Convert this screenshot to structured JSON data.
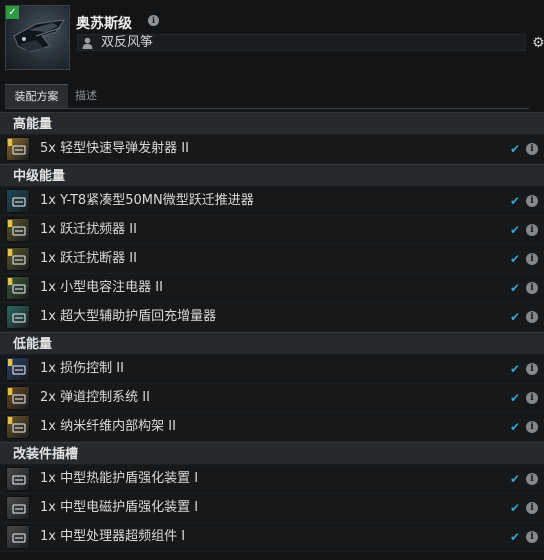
{
  "header": {
    "ship_name": "奥苏斯级",
    "info_icon": "i",
    "fitting_name": "双反风筝",
    "settings_icon": "⚙"
  },
  "tabs": [
    {
      "label": "装配方案",
      "active": true
    },
    {
      "label": "描述",
      "active": false
    }
  ],
  "colors": {
    "accent_check": "#3aa3d6",
    "meta_badge": "#e0c050",
    "valid_corner": "#2c9a3e"
  },
  "sections": [
    {
      "title": "高能量",
      "items": [
        {
          "label": "5x 轻型快速导弹发射器 II",
          "icon": "missile-launcher-icon",
          "icon_color": "#8c6b30",
          "meta": true
        }
      ]
    },
    {
      "title": "中级能量",
      "items": [
        {
          "label": "1x Y-T8紧凑型50MN微型跃迁推进器",
          "icon": "microwarpdrive-icon",
          "icon_color": "#1f4a5b",
          "meta": false
        },
        {
          "label": "1x 跃迁扰频器 II",
          "icon": "warp-scrambler-icon",
          "icon_color": "#5b5a2a",
          "meta": true
        },
        {
          "label": "1x 跃迁扰断器 II",
          "icon": "warp-disruptor-icon",
          "icon_color": "#5b5a2a",
          "meta": true
        },
        {
          "label": "1x 小型电容注电器 II",
          "icon": "capacitor-booster-icon",
          "icon_color": "#3c5a3a",
          "meta": true
        },
        {
          "label": "1x 超大型辅助护盾回充增量器",
          "icon": "shield-booster-icon",
          "icon_color": "#2f6b63",
          "meta": false
        }
      ]
    },
    {
      "title": "低能量",
      "items": [
        {
          "label": "1x 损伤控制 II",
          "icon": "damage-control-icon",
          "icon_color": "#2a3f66",
          "meta": true
        },
        {
          "label": "2x 弹道控制系统 II",
          "icon": "ballistic-control-icon",
          "icon_color": "#6b4a25",
          "meta": true
        },
        {
          "label": "1x 纳米纤维内部构架 II",
          "icon": "nanofiber-structure-icon",
          "icon_color": "#6b5528",
          "meta": true
        }
      ]
    },
    {
      "title": "改装件插槽",
      "items": [
        {
          "label": "1x 中型热能护盾强化装置 I",
          "icon": "rig-thermal-icon",
          "icon_color": "#4a4a4a",
          "meta": false
        },
        {
          "label": "1x 中型电磁护盾强化装置 I",
          "icon": "rig-em-icon",
          "icon_color": "#4a4a4a",
          "meta": false
        },
        {
          "label": "1x 中型处理器超频组件 I",
          "icon": "rig-processor-icon",
          "icon_color": "#4a4a4a",
          "meta": false
        }
      ]
    }
  ],
  "row_check_glyph": "✔",
  "row_info_glyph": "i"
}
